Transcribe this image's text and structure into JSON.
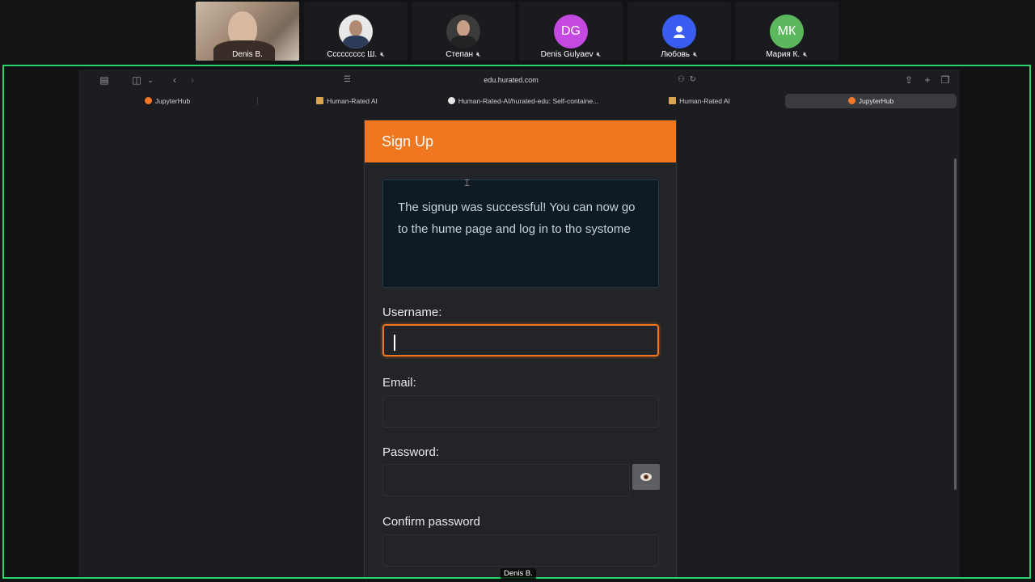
{
  "participants": [
    {
      "name": "Denis B.",
      "type": "photo"
    },
    {
      "name": "Ссссссссс Ш.",
      "type": "photo-round",
      "muted": true
    },
    {
      "name": "Степан",
      "type": "photo-round",
      "muted": true
    },
    {
      "name": "Denis Gulyaev",
      "type": "initials",
      "initials": "DG",
      "color": "#c349e0",
      "muted": true
    },
    {
      "name": "Любовь",
      "type": "user-icon",
      "color": "#3a5cf0",
      "muted": true
    },
    {
      "name": "Мария К.",
      "type": "initials",
      "initials": "МК",
      "color": "#5cb85c",
      "muted": true
    }
  ],
  "browser": {
    "url": "edu.hurated.com",
    "tabs": [
      {
        "label": "JupyterHub",
        "icon": "jupyter-icon",
        "active": false
      },
      {
        "label": "Human-Rated AI",
        "icon": "site-icon",
        "active": false
      },
      {
        "label": "Human-Rated-AI/hurated-edu: Self-containe...",
        "icon": "github-icon",
        "active": false
      },
      {
        "label": "Human-Rated AI",
        "icon": "site-icon",
        "active": false
      },
      {
        "label": "JupyterHub",
        "icon": "jupyter-icon",
        "active": true
      }
    ]
  },
  "signup": {
    "title": "Sign Up",
    "message": "The signup was successful! You can now go to the hume page and log in to tho systome",
    "username_label": "Username:",
    "username_value": "",
    "email_label": "Email:",
    "email_value": "",
    "password_label": "Password:",
    "password_value": "",
    "confirm_label": "Confirm password",
    "confirm_value": ""
  },
  "presenter_name": "Denis B.",
  "colors": {
    "accent": "#f0761f",
    "share_border": "#27d36a",
    "alert_bg": "#0f1a22"
  }
}
